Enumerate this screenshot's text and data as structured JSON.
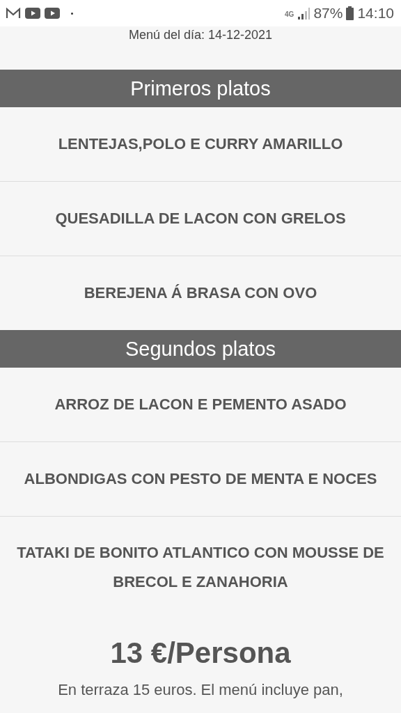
{
  "status_bar": {
    "network": "4G",
    "battery": "87%",
    "time": "14:10"
  },
  "menu_date": "Menú del día: 14-12-2021",
  "sections": [
    {
      "title": "Primeros platos",
      "dishes": [
        "LENTEJAS,POLO E CURRY AMARILLO",
        "QUESADILLA DE LACON CON GRELOS",
        "BEREJENA Á BRASA CON OVO"
      ]
    },
    {
      "title": "Segundos platos",
      "dishes": [
        "ARROZ DE LACON E PEMENTO ASADO",
        "ALBONDIGAS CON PESTO DE MENTA E NOCES",
        "TATAKI DE BONITO ATLANTICO CON MOUSSE DE BRECOL E ZANAHORIA"
      ]
    }
  ],
  "price": "13 €/Persona",
  "note": "En terraza 15 euros. El menú incluye pan,"
}
